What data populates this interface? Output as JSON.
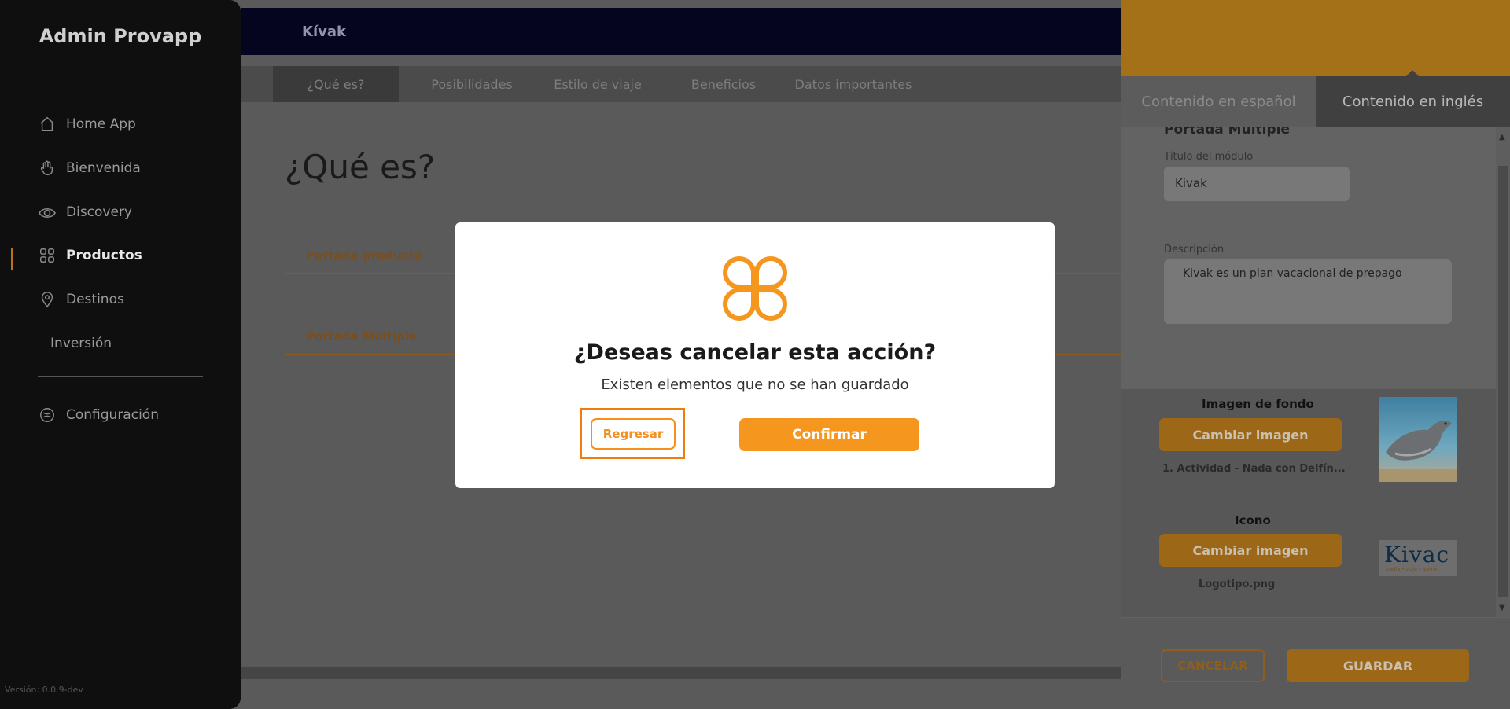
{
  "sidebar": {
    "brand": "Admin Provapp",
    "items": [
      {
        "label": "Home App",
        "icon": "home-icon"
      },
      {
        "label": "Bienvenida",
        "icon": "wave-hand-icon"
      },
      {
        "label": "Discovery",
        "icon": "eye-icon"
      },
      {
        "label": "Productos",
        "icon": "grid-icon"
      },
      {
        "label": "Destinos",
        "icon": "location-pin-icon"
      },
      {
        "label": "Inversión",
        "icon": ""
      }
    ],
    "settings_label": "Configuración",
    "version": "Versión: 0.0.9-dev"
  },
  "header": {
    "title": "Kívak"
  },
  "tabs": [
    "¿Qué es?",
    "Posibilidades",
    "Estilo de viaje",
    "Beneficios",
    "Datos importantes"
  ],
  "main": {
    "page_title": "¿Qué es?",
    "sections": [
      "Portada producto",
      "Portada Múltiple"
    ]
  },
  "right_panel": {
    "tab_es": "Contenido en español",
    "tab_en": "Contenido en inglés",
    "section_title": "Portada Múltiple",
    "module_title_label": "Título del módulo",
    "module_title_value": "Kivak",
    "description_label": "Descripción",
    "description_value": "Kivak es un plan vacacional de prepago",
    "background_label": "Imagen de fondo",
    "change_image_label": "Cambiar imagen",
    "background_file": "1. Actividad - Nada con Delfín...",
    "icon_label": "Icono",
    "icon_file": "Logotipo.png",
    "logo_text": "Kivac",
    "logo_tagline": "sueña • viaje • sonríe",
    "cancel_label": "CANCELAR",
    "save_label": "GUARDAR"
  },
  "modal": {
    "title": "¿Deseas cancelar esta acción?",
    "subtitle": "Existen elementos que no se han guardado",
    "back_label": "Regresar",
    "confirm_label": "Confirmar"
  },
  "colors": {
    "accent": "#f5961f",
    "highlight": "#f07c10",
    "topbar": "#050520"
  }
}
